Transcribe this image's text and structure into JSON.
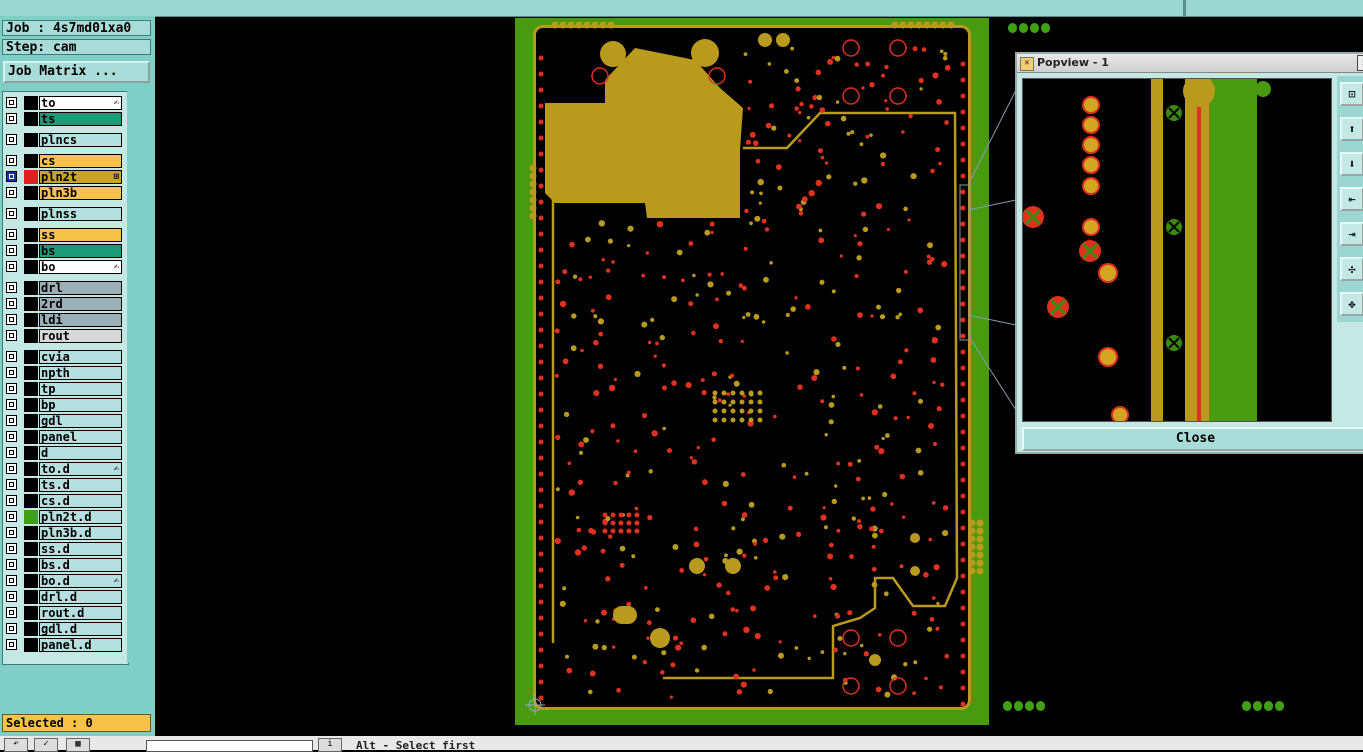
{
  "header": {
    "job_label": "Job : 4s7md01xa0",
    "step_label": "Step: cam",
    "job_matrix_button": "Job Matrix ..."
  },
  "layers": [
    {
      "name": "to",
      "color": "#ffffff",
      "mark": "✍"
    },
    {
      "name": "ts",
      "color": "#1f9a78",
      "mark": ""
    },
    {
      "name": "plncs",
      "color": "#b6dfe0",
      "mark": ""
    },
    {
      "name": "cs",
      "color": "#f5c24a",
      "mark": ""
    },
    {
      "name": "pln2t",
      "color": "#c8a420",
      "mark": "⊞",
      "swatch": "#e02020",
      "selected": true
    },
    {
      "name": "pln3b",
      "color": "#f5c24a",
      "mark": ""
    },
    {
      "name": "plnss",
      "color": "#b6dfe0",
      "mark": ""
    },
    {
      "name": "ss",
      "color": "#f5c24a",
      "mark": ""
    },
    {
      "name": "bs",
      "color": "#1f9a78",
      "mark": ""
    },
    {
      "name": "bo",
      "color": "#ffffff",
      "mark": "✍"
    },
    {
      "name": "drl",
      "color": "#9ab0b8",
      "mark": ""
    },
    {
      "name": "2rd",
      "color": "#9ab0b8",
      "mark": ""
    },
    {
      "name": "ldi",
      "color": "#9ab0b8",
      "mark": ""
    },
    {
      "name": "rout",
      "color": "#d8d8d8",
      "mark": ""
    },
    {
      "name": "cvia",
      "color": "#b6dfe0",
      "mark": ""
    },
    {
      "name": "npth",
      "color": "#b6dfe0",
      "mark": ""
    },
    {
      "name": "tp",
      "color": "#b6dfe0",
      "mark": ""
    },
    {
      "name": "bp",
      "color": "#b6dfe0",
      "mark": ""
    },
    {
      "name": "gdl",
      "color": "#b6dfe0",
      "mark": ""
    },
    {
      "name": "panel",
      "color": "#b6dfe0",
      "mark": ""
    },
    {
      "name": "d",
      "color": "#b6dfe0",
      "mark": ""
    },
    {
      "name": "to.d",
      "color": "#b6dfe0",
      "mark": "✍"
    },
    {
      "name": "ts.d",
      "color": "#b6dfe0",
      "mark": ""
    },
    {
      "name": "cs.d",
      "color": "#b6dfe0",
      "mark": ""
    },
    {
      "name": "pln2t.d",
      "color": "#b6dfe0",
      "mark": "",
      "swatch": "#3fa013"
    },
    {
      "name": "pln3b.d",
      "color": "#b6dfe0",
      "mark": ""
    },
    {
      "name": "ss.d",
      "color": "#b6dfe0",
      "mark": ""
    },
    {
      "name": "bs.d",
      "color": "#b6dfe0",
      "mark": ""
    },
    {
      "name": "bo.d",
      "color": "#b6dfe0",
      "mark": "✍"
    },
    {
      "name": "drl.d",
      "color": "#b6dfe0",
      "mark": ""
    },
    {
      "name": "rout.d",
      "color": "#b6dfe0",
      "mark": ""
    },
    {
      "name": "gdl.d",
      "color": "#b6dfe0",
      "mark": ""
    },
    {
      "name": "panel.d",
      "color": "#b6dfe0",
      "mark": ""
    }
  ],
  "status": {
    "selected_label": "Selected : 0"
  },
  "popview": {
    "title": "Popview - 1",
    "close_label": "Close",
    "tools": [
      "zoom-fit-icon",
      "pan-up-icon",
      "pan-down-icon",
      "pan-left-icon",
      "pan-right-icon",
      "zoom-out-icon",
      "zoom-in-icon"
    ]
  },
  "bottom": {
    "message": "Alt - Select first"
  },
  "colors": {
    "panel_bg": "#7fcfc6",
    "board_green": "#4a9a10",
    "copper": "#b99a1d",
    "pad_red": "#e03020"
  }
}
